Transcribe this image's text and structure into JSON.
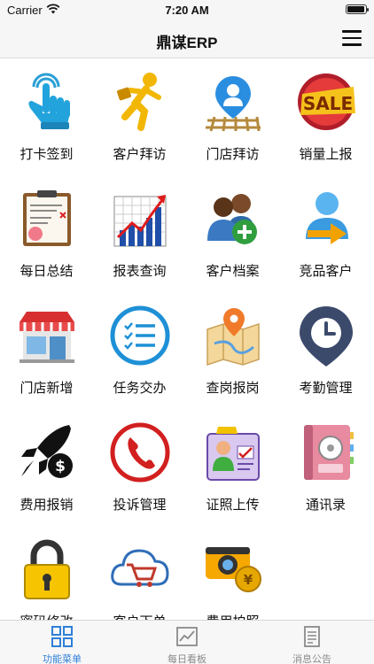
{
  "status_bar": {
    "carrier": "Carrier",
    "time": "7:20 AM"
  },
  "nav": {
    "title": "鼎谋ERP"
  },
  "menu": [
    {
      "label": "打卡签到",
      "icon": "touch-hand-icon"
    },
    {
      "label": "客户拜访",
      "icon": "running-man-icon"
    },
    {
      "label": "门店拜访",
      "icon": "person-pin-road-icon"
    },
    {
      "label": "销量上报",
      "icon": "sale-badge-icon"
    },
    {
      "label": "每日总结",
      "icon": "clipboard-report-icon"
    },
    {
      "label": "报表查询",
      "icon": "growth-chart-icon"
    },
    {
      "label": "客户档案",
      "icon": "add-user-icon"
    },
    {
      "label": "竞品客户",
      "icon": "user-arrow-icon"
    },
    {
      "label": "门店新增",
      "icon": "storefront-icon"
    },
    {
      "label": "任务交办",
      "icon": "task-list-icon"
    },
    {
      "label": "查岗报岗",
      "icon": "map-pin-icon"
    },
    {
      "label": "考勤管理",
      "icon": "clock-pin-icon"
    },
    {
      "label": "费用报销",
      "icon": "rocket-money-icon"
    },
    {
      "label": "投诉管理",
      "icon": "phone-icon"
    },
    {
      "label": "证照上传",
      "icon": "id-card-icon"
    },
    {
      "label": "通讯录",
      "icon": "address-book-icon"
    },
    {
      "label": "密码修改",
      "icon": "padlock-icon"
    },
    {
      "label": "客户下单",
      "icon": "cloud-cart-icon"
    },
    {
      "label": "费用拍照",
      "icon": "camera-coin-icon"
    }
  ],
  "tabs": [
    {
      "label": "功能菜单",
      "icon": "grid-icon",
      "active": true
    },
    {
      "label": "每日看板",
      "icon": "line-chart-icon",
      "active": false
    },
    {
      "label": "消息公告",
      "icon": "document-icon",
      "active": false
    }
  ],
  "colors": {
    "accent": "#2f7fd8",
    "tab_inactive": "#8a8a8a"
  }
}
